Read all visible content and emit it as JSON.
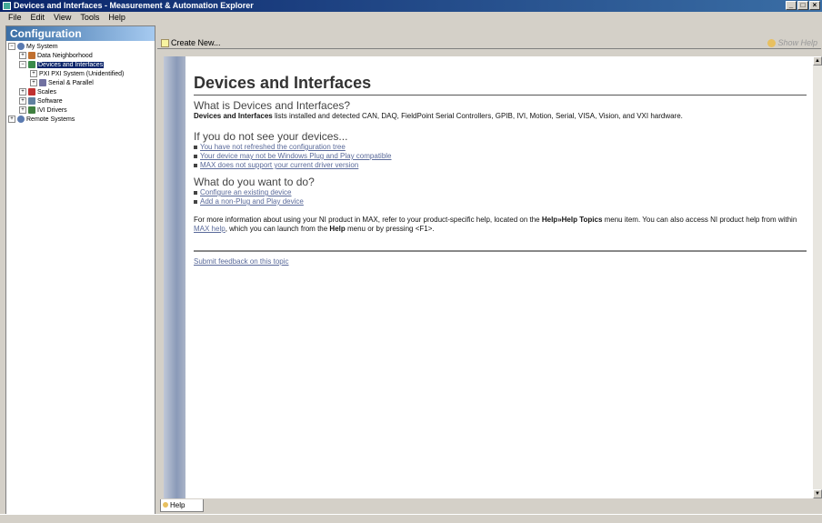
{
  "window": {
    "title": "Devices and Interfaces - Measurement & Automation Explorer",
    "controls": [
      "_",
      "□",
      "×"
    ]
  },
  "menu": [
    "File",
    "Edit",
    "View",
    "Tools",
    "Help"
  ],
  "left_pane": {
    "header": "Configuration",
    "tree": [
      {
        "label": "My System",
        "expander": "−",
        "icon": "computer-icon",
        "color": "#5a7ab0"
      },
      {
        "label": "Data Neighborhood",
        "expander": "+",
        "icon": "data-neighborhood-icon",
        "color": "#c07030"
      },
      {
        "label": "Devices and Interfaces",
        "expander": "−",
        "icon": "devices-icon",
        "color": "#3a8a4a",
        "selected": true
      },
      {
        "label": "PXI PXI System (Unidentified)",
        "expander": "+",
        "icon": "pxi-icon",
        "color": "#606060"
      },
      {
        "label": "Serial & Parallel",
        "expander": "+",
        "icon": "serial-icon",
        "color": "#7070a0"
      },
      {
        "label": "Scales",
        "expander": "+",
        "icon": "scales-icon",
        "color": "#c03030"
      },
      {
        "label": "Software",
        "expander": "+",
        "icon": "software-icon",
        "color": "#6080a0"
      },
      {
        "label": "IVI Drivers",
        "expander": "+",
        "icon": "ivi-icon",
        "color": "#408040"
      },
      {
        "label": "Remote Systems",
        "expander": "+",
        "icon": "remote-systems-icon",
        "color": "#5a7ab0"
      }
    ]
  },
  "toolbar": {
    "create_new": "Create New...",
    "help_toggle": "Show Help"
  },
  "content": {
    "title": "Devices and Interfaces",
    "section1_heading": "What is Devices and Interfaces?",
    "section1_bold": "Devices and Interfaces",
    "section1_text": " lists installed and detected CAN, DAQ, FieldPoint Serial Controllers, GPIB, IVI, Motion, Serial, VISA, Vision, and VXI hardware.",
    "section2_heading": "If you do not see your devices...",
    "section2_links": [
      "You have not refreshed the configuration tree",
      "Your device may not be Windows Plug and Play compatible",
      "MAX does not support your current driver version"
    ],
    "section3_heading": "What do you want to do?",
    "section3_links": [
      "Configure an existing device",
      "Add a non-Plug and Play device"
    ],
    "info_part1": "For more information about using your NI product in MAX, refer to your product-specific help, located on the ",
    "info_bold1": "Help»Help Topics",
    "info_part2": " menu item. You can also access NI product help from within ",
    "info_link": "MAX help",
    "info_part3": ", which you can launch from the ",
    "info_bold2": "Help",
    "info_part4": " menu or by pressing <F1>.",
    "feedback_link": "Submit feedback on this topic"
  },
  "bottom_tab": "Help"
}
